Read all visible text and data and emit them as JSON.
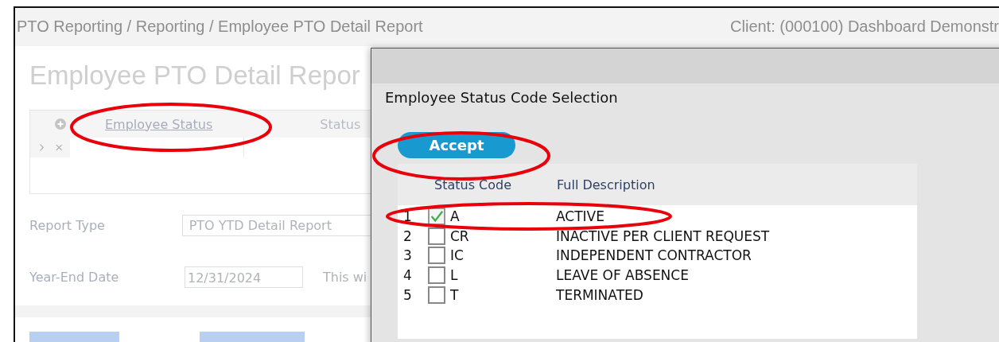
{
  "header": {
    "breadcrumb": "PTO Reporting / Reporting / Employee PTO Detail Report",
    "client": "Client: (000100) Dashboard Demonstr"
  },
  "page": {
    "title": "Employee PTO Detail Repor",
    "filter_grid": {
      "columns": [
        "Employee Status",
        "Status"
      ]
    },
    "fields": [
      {
        "label": "Report Type",
        "value": "PTO YTD Detail Report",
        "kind": "select"
      },
      {
        "label": "Year-End Date",
        "value": "12/31/2024",
        "kind": "date",
        "note": "This wi"
      }
    ]
  },
  "dialog": {
    "title": "Employee Status Code Selection",
    "accept": "Accept",
    "columns": [
      "Status Code",
      "Full Description"
    ],
    "rows": [
      {
        "number": "1",
        "checked": true,
        "code": "A",
        "description": "ACTIVE"
      },
      {
        "number": "2",
        "checked": false,
        "code": "CR",
        "description": "INACTIVE PER CLIENT REQUEST"
      },
      {
        "number": "3",
        "checked": false,
        "code": "IC",
        "description": "INDEPENDENT CONTRACTOR"
      },
      {
        "number": "4",
        "checked": false,
        "code": "L",
        "description": "LEAVE OF ABSENCE"
      },
      {
        "number": "5",
        "checked": false,
        "code": "T",
        "description": "TERMINATED"
      }
    ]
  },
  "annotations": [
    {
      "kind": "ellipse"
    },
    {
      "kind": "ellipse"
    },
    {
      "kind": "ellipse"
    }
  ]
}
